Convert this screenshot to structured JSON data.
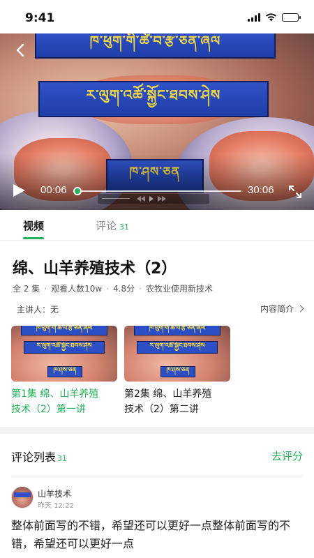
{
  "status_bar": {
    "time": "9:41",
    "icons": [
      "signal-icon",
      "wifi-icon",
      "battery-icon"
    ]
  },
  "video": {
    "current_time": "00:06",
    "total_time": "30:06",
    "progress": 0.003,
    "overlay_lines": [
      "ཁ་ཕུག་གི་ཚེ་བ་རྩ་ཅན་ཞལ",
      "ར་ལུག་འཚོ་སྐྱོང་ཐབས་ཤེས",
      "ཁ་ཤས་ཅན"
    ],
    "icons": [
      "back-icon",
      "play-icon",
      "fullscreen-icon"
    ]
  },
  "tabs": [
    {
      "label": "视频",
      "active": true
    },
    {
      "label": "评论",
      "count": "31",
      "active": false
    }
  ],
  "course": {
    "title": "绵、山羊养殖技术（2）",
    "meta": [
      "全 2 集",
      "观看人数10w",
      "4.8分",
      "农牧业使用新技术"
    ],
    "lecturer": "主讲人：无",
    "intro_link": "内容简介"
  },
  "episodes": [
    {
      "title_line1": "第1集  绵、山羊养殖",
      "title_line2": "技术（2）第一讲",
      "active": true
    },
    {
      "title_line1": "第2集  绵、山羊养殖",
      "title_line2": "技术（2）第二讲",
      "active": false
    }
  ],
  "comments": {
    "header": "评论列表",
    "count": "31",
    "rate_label": "去评分",
    "items": [
      {
        "user": "山羊技术",
        "time": "昨天 12:22",
        "text": "整体前面写的不错，希望还可以更好一点整体前面写的不错，希望还可以更好一点"
      }
    ]
  },
  "colors": {
    "accent": "#25b158",
    "banner_blue": "#2d4fc6",
    "banner_text": "#f2d646"
  }
}
